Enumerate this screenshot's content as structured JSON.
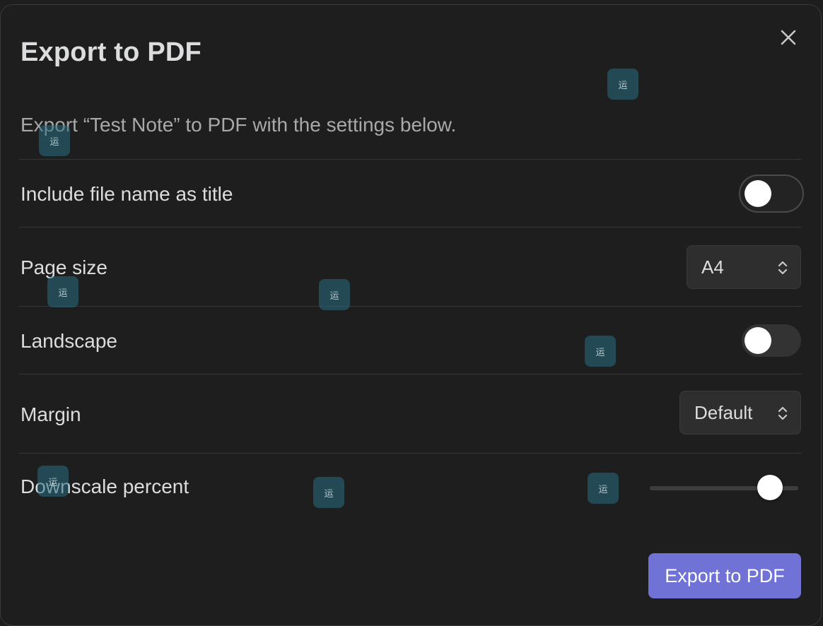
{
  "dialog": {
    "title": "Export to PDF",
    "description": "Export “Test Note” to PDF with the settings below.",
    "close_icon": "close-icon"
  },
  "settings": {
    "include_file_name": {
      "label": "Include file name as title",
      "enabled": false
    },
    "page_size": {
      "label": "Page size",
      "value": "A4"
    },
    "landscape": {
      "label": "Landscape",
      "enabled": false
    },
    "margin": {
      "label": "Margin",
      "value": "Default"
    },
    "downscale_percent": {
      "label": "Downscale percent",
      "slider_fraction": 0.81
    }
  },
  "actions": {
    "export_label": "Export to PDF"
  },
  "colors": {
    "background": "#1e1e1e",
    "accent": "#7072d6",
    "text": "#dcddde",
    "muted_text": "#a9a9a9"
  },
  "watermark": {
    "glyph": "运"
  }
}
